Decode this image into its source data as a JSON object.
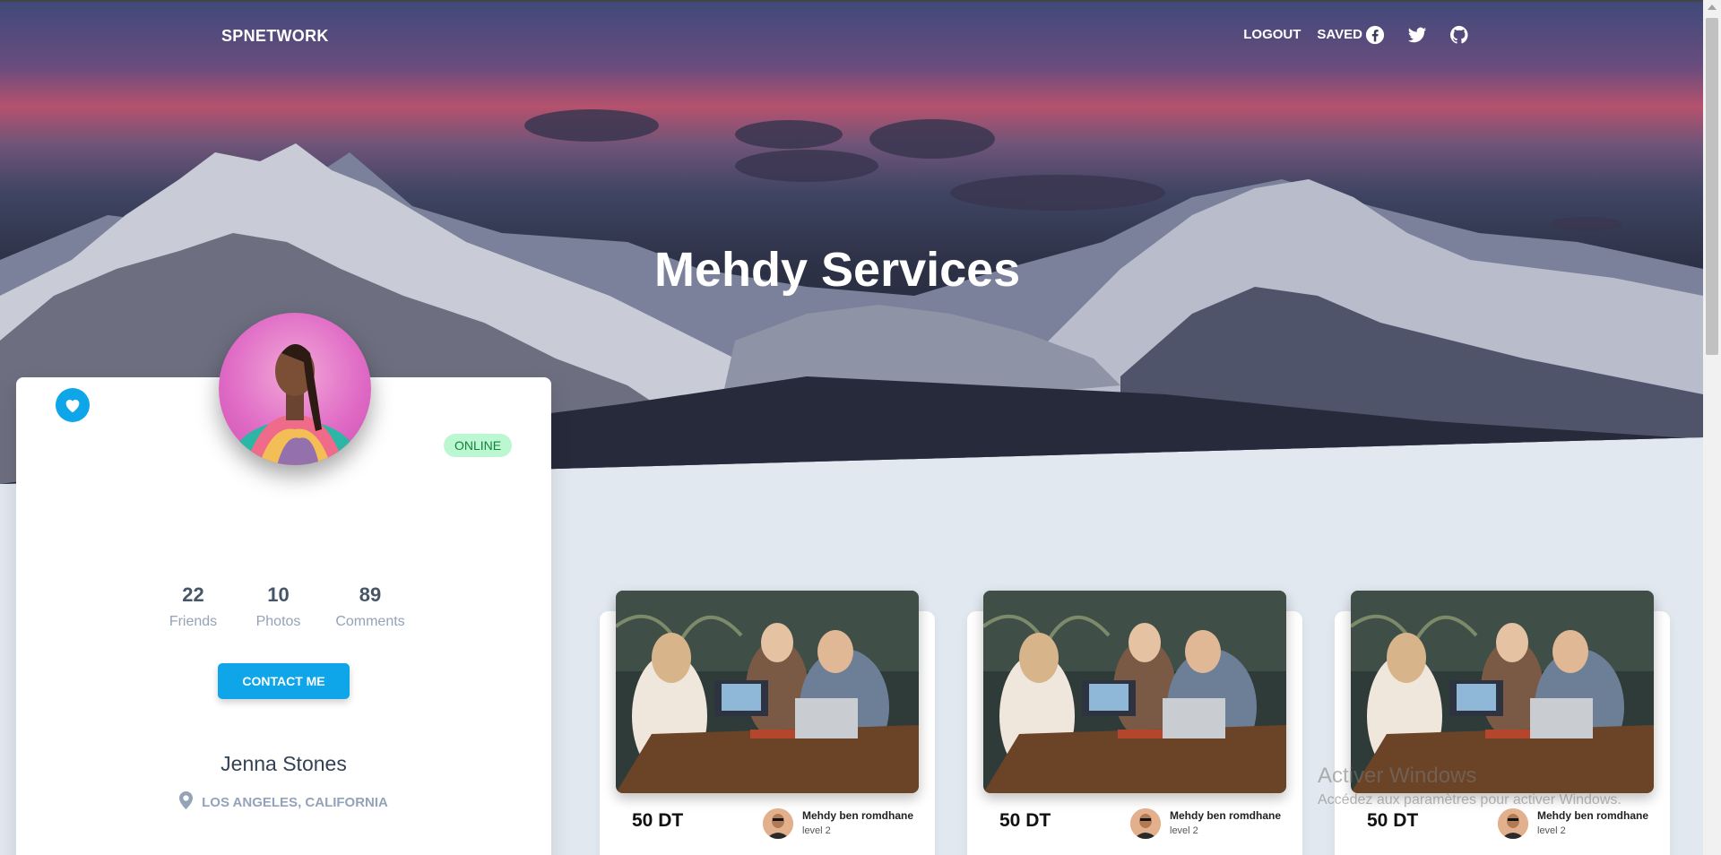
{
  "nav": {
    "brand": "SPNETWORK",
    "links": [
      "LOGOUT",
      "SAVED"
    ],
    "social": [
      "facebook-icon",
      "twitter-icon",
      "github-icon"
    ]
  },
  "hero": {
    "title": "Mehdy Services"
  },
  "profile": {
    "status": "ONLINE",
    "stats": [
      {
        "value": "22",
        "label": "Friends"
      },
      {
        "value": "10",
        "label": "Photos"
      },
      {
        "value": "89",
        "label": "Comments"
      }
    ],
    "contact_label": "CONTACT ME",
    "name": "Jenna Stones",
    "location": "LOS ANGELES, CALIFORNIA"
  },
  "services": [
    {
      "price": "50 DT",
      "seller": "Mehdy ben romdhane",
      "level": "level 2"
    },
    {
      "price": "50 DT",
      "seller": "Mehdy ben romdhane",
      "level": "level 2"
    },
    {
      "price": "50 DT",
      "seller": "Mehdy ben romdhane",
      "level": "level 2"
    }
  ],
  "watermark": {
    "line1": "Activer Windows",
    "line2": "Accédez aux paramètres pour activer Windows."
  },
  "colors": {
    "accent": "#0ea5e9",
    "online_bg": "#bbf7d0",
    "page_bg": "#e2e8f0"
  }
}
